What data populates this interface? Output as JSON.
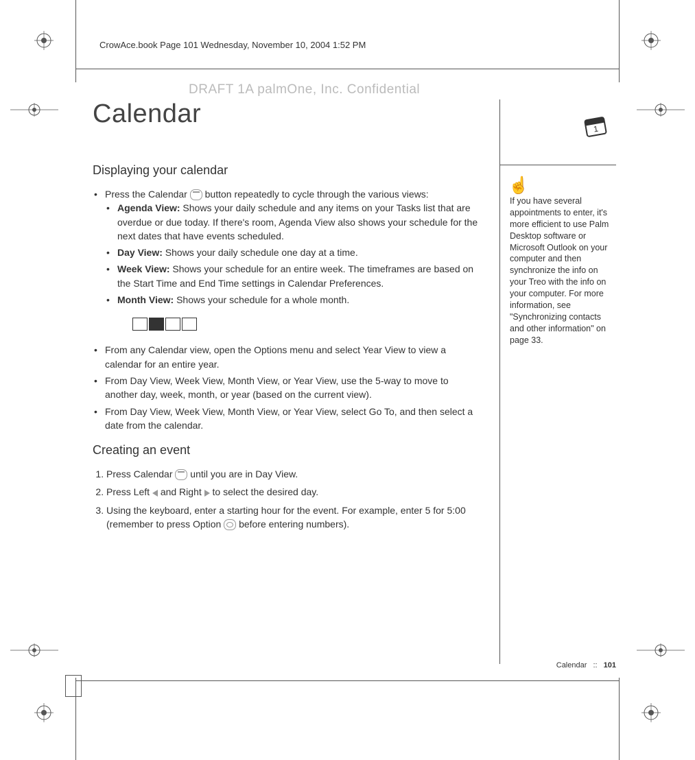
{
  "header": {
    "running_head": "CrowAce.book  Page 101  Wednesday, November 10, 2004  1:52 PM"
  },
  "watermark": "DRAFT 1A  palmOne, Inc.   Confidential",
  "title": "Calendar",
  "section1": {
    "heading": "Displaying your calendar",
    "intro_before": "Press the Calendar ",
    "intro_after": " button repeatedly to cycle through the various views:",
    "views": [
      {
        "label": "Agenda View:",
        "text": " Shows your daily schedule and any items on your Tasks list that are overdue or due today. If there's room, Agenda View also shows your schedule for the next dates that have events scheduled."
      },
      {
        "label": "Day View:",
        "text": " Shows your daily schedule one day at a time."
      },
      {
        "label": "Week View:",
        "text": " Shows your schedule for an entire week. The timeframes are based on the Start Time and End Time settings in Calendar Preferences."
      },
      {
        "label": "Month View:",
        "text": " Shows your schedule for a whole month."
      }
    ],
    "bullets2": [
      "From any Calendar view, open the Options menu and select Year View to view a calendar for an entire year.",
      "From Day View, Week View, Month View, or Year View, use the 5-way to move to another day, week, month, or year (based on the current view).",
      "From Day View, Week View, Month View, or Year View, select Go To, and then select a date from the calendar."
    ]
  },
  "section2": {
    "heading": "Creating an event",
    "step1_before": "Press Calendar ",
    "step1_after": " until you are in Day View.",
    "step2_before": "Press Left ",
    "step2_mid": " and Right ",
    "step2_after": " to select the desired day.",
    "step3_before": "Using the keyboard, enter a starting hour for the event. For example, enter 5 for 5:00 (remember to press Option ",
    "step3_after": " before entering numbers)."
  },
  "sidebar": {
    "tip": "If you have several appointments to enter, it's more efficient to use Palm Desktop software or Microsoft Outlook on your computer and then synchronize the info on your Treo with the info on your computer. For more information, see \"Synchronizing contacts and other information\" on page 33."
  },
  "footer": {
    "section": "Calendar",
    "separator": "::",
    "page": "101"
  },
  "icons": {
    "calendar_button": "calendar-button-icon",
    "option_button": "option-button-icon",
    "arrow_left": "arrow-left-icon",
    "arrow_right": "arrow-right-icon",
    "view_agenda": "agenda-view-icon",
    "view_day": "day-view-icon",
    "view_week": "week-view-icon",
    "view_month": "month-view-icon",
    "tip_hand": "tip-hand-icon",
    "calendar_badge": "calendar-badge-icon",
    "crop_registration": "registration-mark-icon"
  }
}
